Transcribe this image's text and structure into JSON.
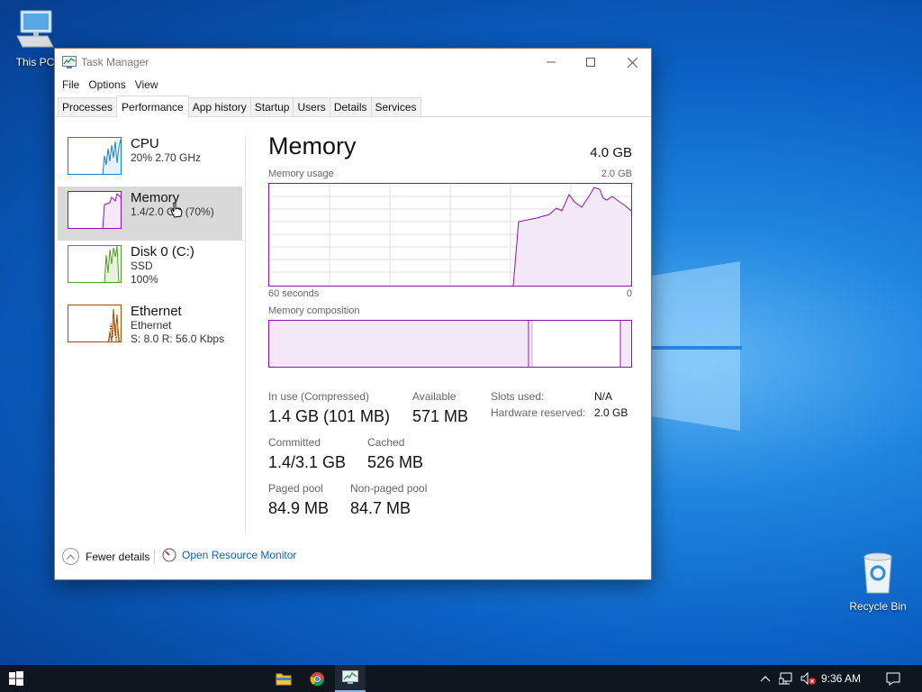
{
  "desktop": {
    "icons": [
      {
        "label": "This PC",
        "icon": "computer-icon"
      },
      {
        "label": "Recycle Bin",
        "icon": "recycle-bin-icon"
      }
    ]
  },
  "window": {
    "title": "Task Manager",
    "controls": [
      "minimize",
      "maximize",
      "close"
    ]
  },
  "menu": [
    "File",
    "Options",
    "View"
  ],
  "tabs": [
    {
      "label": "Processes",
      "active": false
    },
    {
      "label": "Performance",
      "active": true
    },
    {
      "label": "App history",
      "active": false
    },
    {
      "label": "Startup",
      "active": false
    },
    {
      "label": "Users",
      "active": false
    },
    {
      "label": "Details",
      "active": false
    },
    {
      "label": "Services",
      "active": false
    }
  ],
  "sidebar": [
    {
      "name": "CPU",
      "line1": "20%  2.70 GHz",
      "line2": "",
      "color": "#1780c5",
      "selected": false
    },
    {
      "name": "Memory",
      "line1": "1.4/2.0 GB (70%)",
      "line2": "",
      "color": "#8b12ae",
      "selected": true
    },
    {
      "name": "Disk 0 (C:)",
      "line1": "SSD",
      "line2": "100%",
      "color": "#4ca021",
      "selected": false
    },
    {
      "name": "Ethernet",
      "line1": "Ethernet",
      "line2": "S: 8.0  R: 56.0 Kbps",
      "color": "#a74f01",
      "selected": false
    }
  ],
  "memory": {
    "title": "Memory",
    "total": "4.0 GB",
    "usage_label": "Memory usage",
    "usage_max": "2.0 GB",
    "x_left": "60 seconds",
    "x_right": "0",
    "composition_label": "Memory composition",
    "stats": {
      "in_use_label": "In use (Compressed)",
      "in_use_value": "1.4 GB (101 MB)",
      "available_label": "Available",
      "available_value": "571 MB",
      "committed_label": "Committed",
      "committed_value": "1.4/3.1 GB",
      "cached_label": "Cached",
      "cached_value": "526 MB",
      "paged_label": "Paged pool",
      "paged_value": "84.9 MB",
      "nonpaged_label": "Non-paged pool",
      "nonpaged_value": "84.7 MB"
    },
    "details": {
      "slots_label": "Slots used:",
      "slots_value": "N/A",
      "hw_label": "Hardware reserved:",
      "hw_value": "2.0 GB"
    },
    "composition_fraction": {
      "in_use": 0.72,
      "modified": 0.01,
      "standby": 0.25
    }
  },
  "footer": {
    "fewer_details": "Fewer details",
    "open_resource_monitor": "Open Resource Monitor"
  },
  "taskbar": {
    "apps": [
      {
        "icon": "file-explorer-icon",
        "active": false
      },
      {
        "icon": "chrome-icon",
        "active": false
      },
      {
        "icon": "task-manager-icon",
        "active": true
      }
    ],
    "time": "9:36 AM"
  },
  "accent": {
    "memory": "#8b12ae",
    "link": "#0d5fb0"
  }
}
